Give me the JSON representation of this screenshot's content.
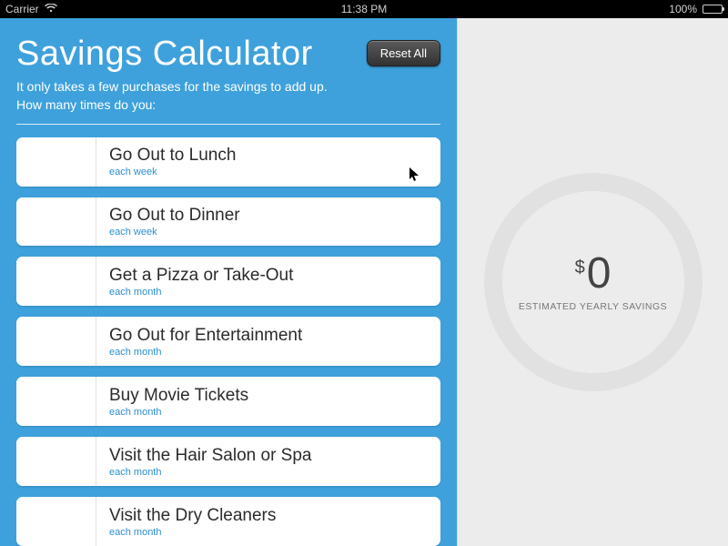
{
  "statusbar": {
    "carrier": "Carrier",
    "time": "11:38 PM",
    "battery": "100%"
  },
  "header": {
    "title": "Savings Calculator",
    "reset_label": "Reset All",
    "subtitle_line1": "It only takes a few purchases for the savings to add up.",
    "subtitle_line2": "How many times do you:"
  },
  "rows": [
    {
      "label": "Go Out to Lunch",
      "frequency": "each week"
    },
    {
      "label": "Go Out to Dinner",
      "frequency": "each week"
    },
    {
      "label": "Get a Pizza or Take-Out",
      "frequency": "each month"
    },
    {
      "label": "Go Out for Entertainment",
      "frequency": "each month"
    },
    {
      "label": "Buy Movie Tickets",
      "frequency": "each month"
    },
    {
      "label": "Visit the Hair Salon or Spa",
      "frequency": "each month"
    },
    {
      "label": "Visit the Dry Cleaners",
      "frequency": "each month"
    }
  ],
  "savings": {
    "currency": "$",
    "amount": "0",
    "label": "ESTIMATED YEARLY SAVINGS"
  }
}
